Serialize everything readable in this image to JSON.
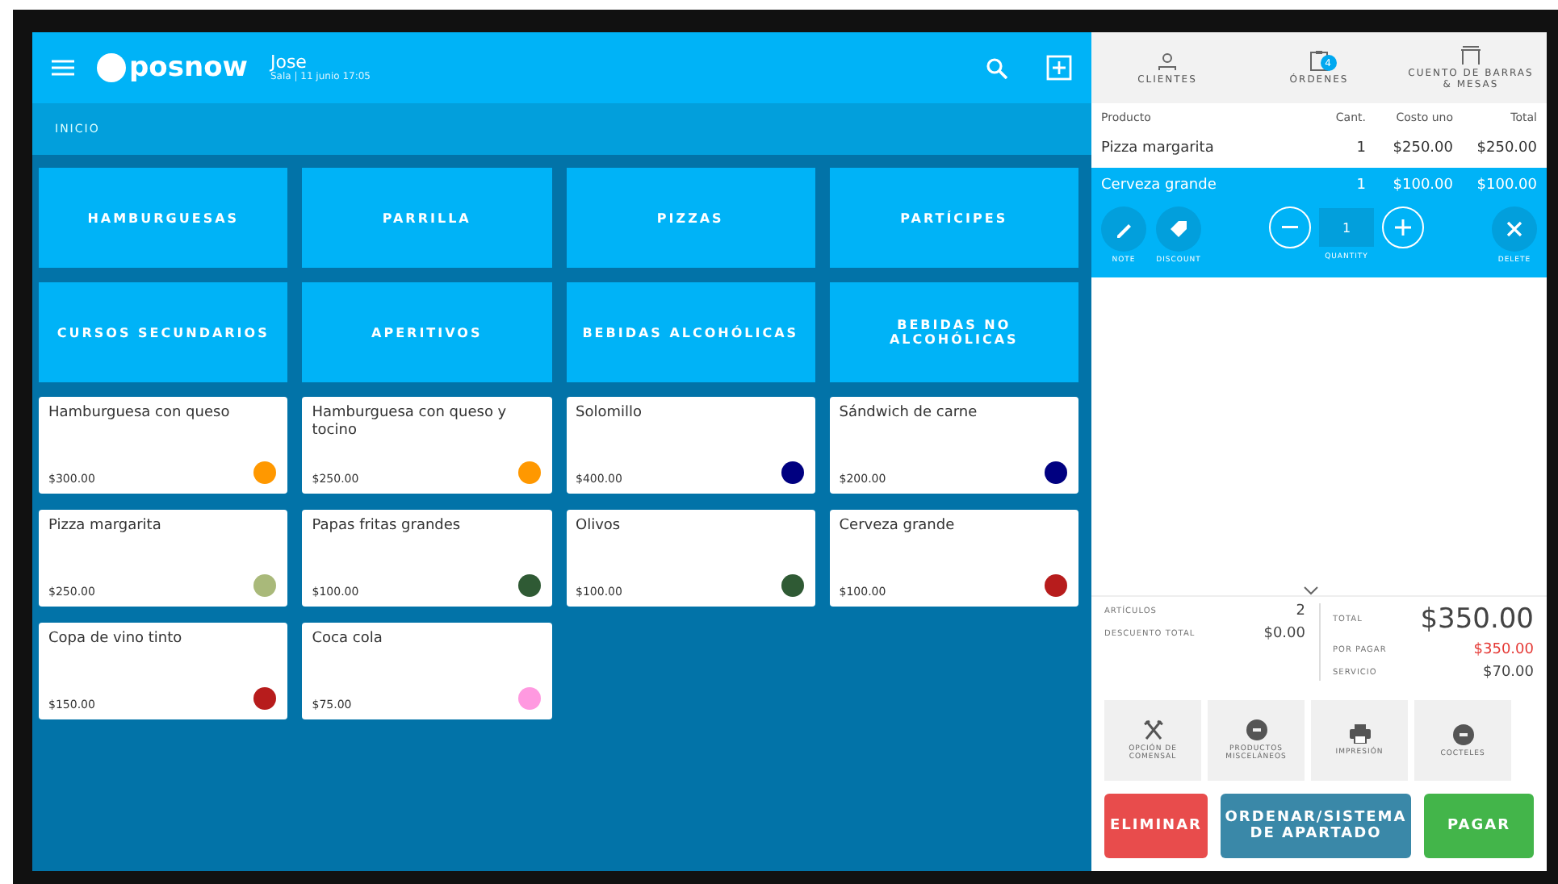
{
  "header": {
    "logo": "posnow",
    "user": "Jose",
    "subtitle": "Sala | 11 junio 17:05"
  },
  "breadcrumb": "INICIO",
  "categories": [
    "HAMBURGUESAS",
    "PARRILLA",
    "PIZZAS",
    "PARTÍCIPES",
    "CURSOS SECUNDARIOS",
    "APERITIVOS",
    "BEBIDAS ALCOHÓLICAS",
    "BEBIDAS NO ALCOHÓLICAS"
  ],
  "products": [
    {
      "name": "Hamburguesa con queso",
      "price": "$300.00",
      "color": "#ff9800"
    },
    {
      "name": "Hamburguesa con queso y tocino",
      "price": "$250.00",
      "color": "#ff9800"
    },
    {
      "name": "Solomillo",
      "price": "$400.00",
      "color": "#000080"
    },
    {
      "name": "Sándwich de carne",
      "price": "$200.00",
      "color": "#000080"
    },
    {
      "name": "Pizza margarita",
      "price": "$250.00",
      "color": "#a9b97a"
    },
    {
      "name": "Papas fritas grandes",
      "price": "$100.00",
      "color": "#2f5a34"
    },
    {
      "name": "Olivos",
      "price": "$100.00",
      "color": "#2f5a34"
    },
    {
      "name": "Cerveza grande",
      "price": "$100.00",
      "color": "#b71c1c"
    },
    {
      "name": "Copa de vino tinto",
      "price": "$150.00",
      "color": "#b71c1c"
    },
    {
      "name": "Coca cola",
      "price": "$75.00",
      "color": "#ff99e0"
    }
  ],
  "order_tabs": [
    {
      "label": "CLIENTES"
    },
    {
      "label": "ÓRDENES",
      "badge": "4"
    },
    {
      "label": "CUENTO DE BARRAS & MESAS"
    }
  ],
  "order_table": {
    "columns": [
      "Producto",
      "Cant.",
      "Costo uno",
      "Total"
    ],
    "rows": [
      {
        "cells": [
          "Pizza margarita",
          "1",
          "$250.00",
          "$250.00"
        ],
        "selected": false
      },
      {
        "cells": [
          "Cerveza grande",
          "1",
          "$100.00",
          "$100.00"
        ],
        "selected": true
      }
    ]
  },
  "row_actions": {
    "note": "NOTE",
    "discount": "DISCOUNT",
    "quantity": "1",
    "quantity_label": "QUANTITY",
    "delete": "DELETE"
  },
  "summary": {
    "left": [
      {
        "label": "ARTÍCULOS",
        "value": "2"
      },
      {
        "label": "DESCUENTO TOTAL",
        "value": "$0.00"
      }
    ],
    "right": [
      {
        "label": "TOTAL",
        "value": "$350.00",
        "kind": "big"
      },
      {
        "label": "POR PAGAR",
        "value": "$350.00",
        "kind": "due"
      },
      {
        "label": "SERVICIO",
        "value": "$70.00",
        "kind": "plain"
      }
    ]
  },
  "tools": [
    {
      "label": "OPCIÓN DE COMENSAL"
    },
    {
      "label": "PRODUCTOS MISCELÁNEOS"
    },
    {
      "label": "IMPRESIÓN"
    },
    {
      "label": "COCTELES"
    }
  ],
  "buttons": [
    {
      "label": "ELIMINAR",
      "kind": "danger"
    },
    {
      "label": "ORDENAR/SISTEMA DE APARTADO",
      "kind": "secondary"
    },
    {
      "label": "PAGAR",
      "kind": "primary"
    }
  ]
}
